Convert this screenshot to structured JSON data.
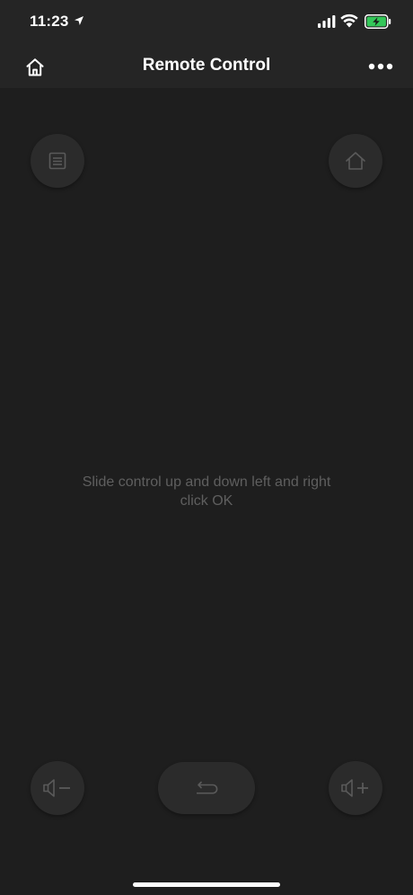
{
  "status_bar": {
    "time": "11:23",
    "battery_color": "#34c759"
  },
  "nav": {
    "title": "Remote Control",
    "left_icon": "home-icon",
    "right_icon": "more-icon"
  },
  "remote": {
    "hint_line1": "Slide control up and down left and right",
    "hint_line2": "click OK",
    "buttons": {
      "menu": "menu-icon",
      "home": "home-icon",
      "volume_down": "volume-down-icon",
      "back": "back-icon",
      "volume_up": "volume-up-icon"
    }
  },
  "colors": {
    "background": "#1e1e1e",
    "bar_background": "#252525",
    "button_background": "#2b2b2b",
    "icon_muted": "#5a5a5a",
    "hint_text": "#5f5f5f"
  }
}
